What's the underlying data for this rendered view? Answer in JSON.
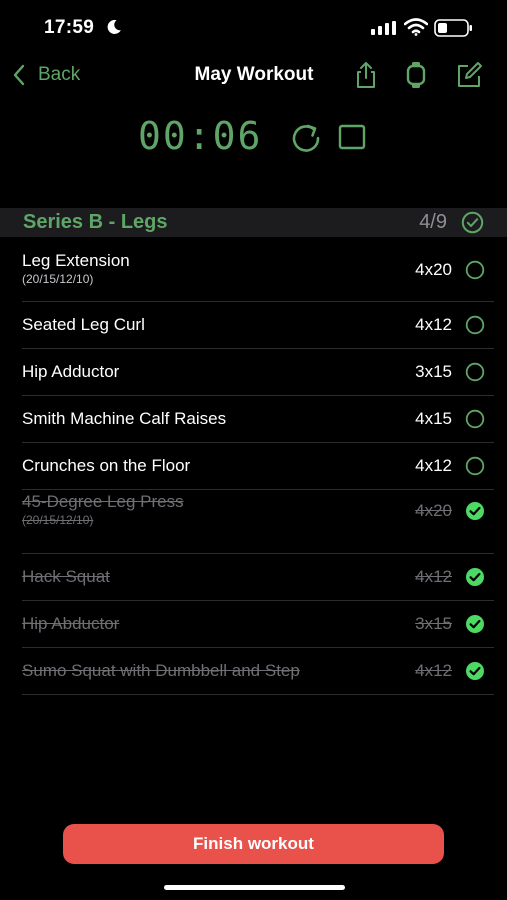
{
  "status_bar": {
    "time": "17:59"
  },
  "nav": {
    "back_label": "Back",
    "title": "May Workout"
  },
  "timer": {
    "display": "00:06"
  },
  "section": {
    "title": "Series B - Legs",
    "count": "4/9"
  },
  "colors": {
    "accent": "#5fa567",
    "finish": "#e8524a",
    "check_done": "#4cd964"
  },
  "exercises": [
    {
      "name": "Leg Extension",
      "sub": "(20/15/12/10)",
      "sets": "4x20",
      "done": false
    },
    {
      "name": "Seated Leg Curl",
      "sub": "",
      "sets": "4x12",
      "done": false
    },
    {
      "name": "Hip Adductor",
      "sub": "",
      "sets": "3x15",
      "done": false
    },
    {
      "name": "Smith Machine Calf Raises",
      "sub": "",
      "sets": "4x15",
      "done": false
    },
    {
      "name": "Crunches on the Floor",
      "sub": "",
      "sets": "4x12",
      "done": false
    },
    {
      "name": "45-Degree Leg Press",
      "sub": "(20/15/12/10)",
      "sets": "4x20",
      "done": true
    },
    {
      "name": "Hack Squat",
      "sub": "",
      "sets": "4x12",
      "done": true
    },
    {
      "name": "Hip Abductor",
      "sub": "",
      "sets": "3x15",
      "done": true
    },
    {
      "name": "Sumo Squat with Dumbbell and Step",
      "sub": "",
      "sets": "4x12",
      "done": true
    }
  ],
  "finish_label": "Finish workout",
  "icons": {
    "back": "chevron-left-icon",
    "share": "share-icon",
    "watch": "watch-icon",
    "edit": "edit-icon",
    "reset": "reset-icon",
    "stop": "stop-icon",
    "check": "check-circle-icon"
  }
}
